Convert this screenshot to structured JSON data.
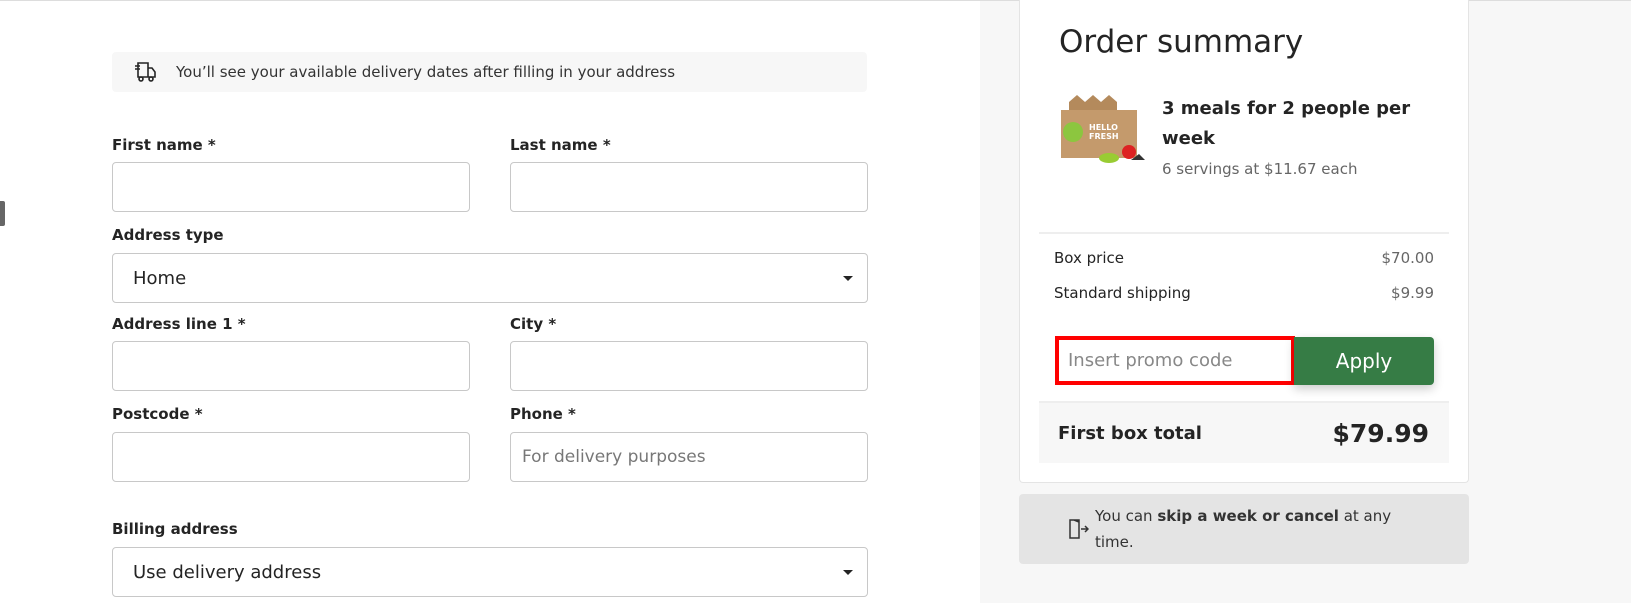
{
  "delivery_notice": {
    "icon": "delivery-truck-icon",
    "text": "You’ll see your available delivery dates after filling in your address"
  },
  "form": {
    "first_name": {
      "label": "First name *",
      "value": ""
    },
    "last_name": {
      "label": "Last name *",
      "value": ""
    },
    "address_type": {
      "label": "Address type",
      "value": "Home"
    },
    "address_line1": {
      "label": "Address line 1 *",
      "value": ""
    },
    "city": {
      "label": "City *",
      "value": ""
    },
    "postcode": {
      "label": "Postcode *",
      "value": ""
    },
    "phone": {
      "label": "Phone *",
      "placeholder": "For delivery purposes",
      "value": ""
    },
    "billing_address": {
      "label": "Billing address",
      "value": "Use delivery address"
    }
  },
  "summary": {
    "title": "Order summary",
    "product_title": "3 meals for 2 people per week",
    "product_subtitle": "6 servings at $11.67 each",
    "product_logo": "HELLO FRESH",
    "lines": [
      {
        "label": "Box price",
        "value": "$70.00"
      },
      {
        "label": "Standard shipping",
        "value": "$9.99"
      }
    ],
    "promo_placeholder": "Insert promo code",
    "apply_label": "Apply",
    "total_label": "First box total",
    "total_value": "$79.99",
    "skip_prefix": "You can ",
    "skip_bold": "skip a week or cancel",
    "skip_suffix": " at any time."
  },
  "colors": {
    "accent": "#367c45",
    "highlight": "#ff0000"
  }
}
